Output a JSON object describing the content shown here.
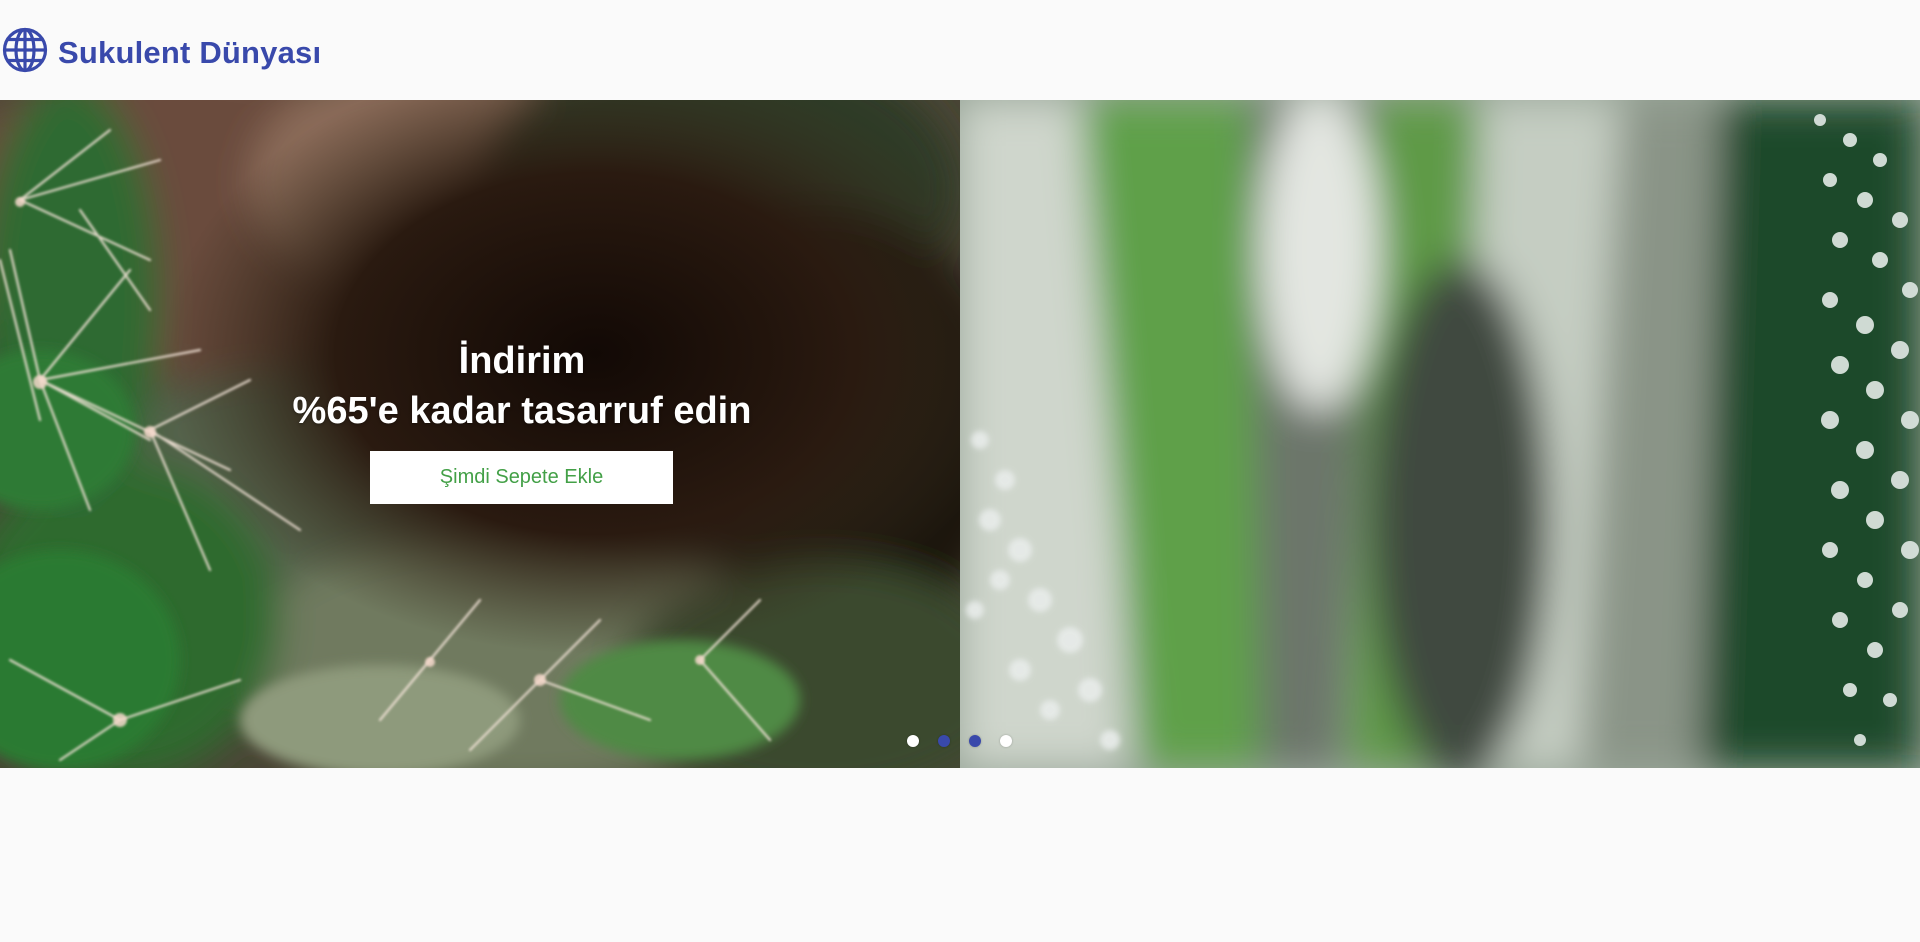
{
  "header": {
    "brand_title": "Sukulent Dünyası",
    "brand_icon": "globe-icon",
    "brand_color": "#3949ab"
  },
  "hero": {
    "title_line1": "İndirim",
    "title_line2": "%65'e kadar tasarruf edin",
    "cta_label": "Şimdi Sepete Ekle",
    "cta_text_color": "#43a047",
    "slides": [
      {
        "image": "cactus-closeup-photo"
      },
      {
        "image": "succulent-leaves-photo"
      }
    ],
    "indicators": [
      {
        "active": false
      },
      {
        "active": true
      },
      {
        "active": true
      },
      {
        "active": false
      }
    ],
    "indicator_active_color": "#3949ab"
  }
}
